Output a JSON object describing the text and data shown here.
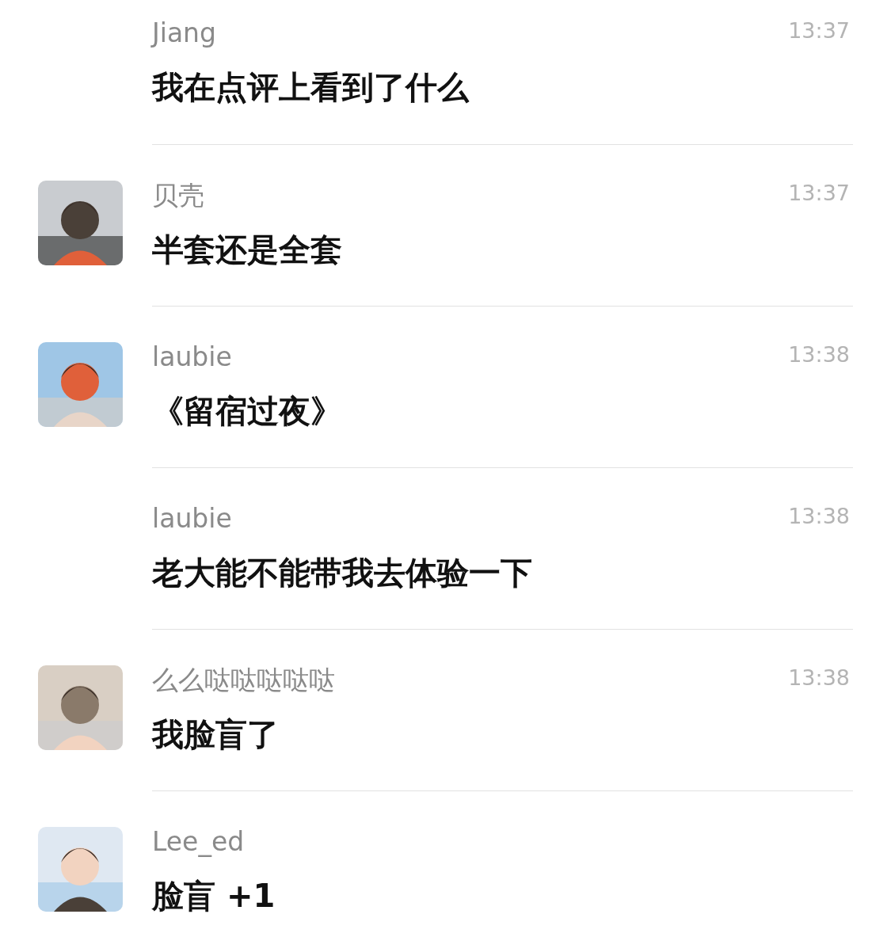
{
  "messages": [
    {
      "sender": "Jiang",
      "time": "13:37",
      "text": "我在点评上看到了什么",
      "avatar": false
    },
    {
      "sender": "贝壳",
      "time": "13:37",
      "text": "半套还是全套",
      "avatar": true
    },
    {
      "sender": "laubie",
      "time": "13:38",
      "text": "《留宿过夜》",
      "avatar": true
    },
    {
      "sender": "laubie",
      "time": "13:38",
      "text": "老大能不能带我去体验一下",
      "avatar": false
    },
    {
      "sender": "么么哒哒哒哒哒",
      "time": "13:38",
      "text": "我脸盲了",
      "avatar": true
    },
    {
      "sender": "Lee_ed",
      "text": "脸盲 +1",
      "avatar": true
    }
  ]
}
